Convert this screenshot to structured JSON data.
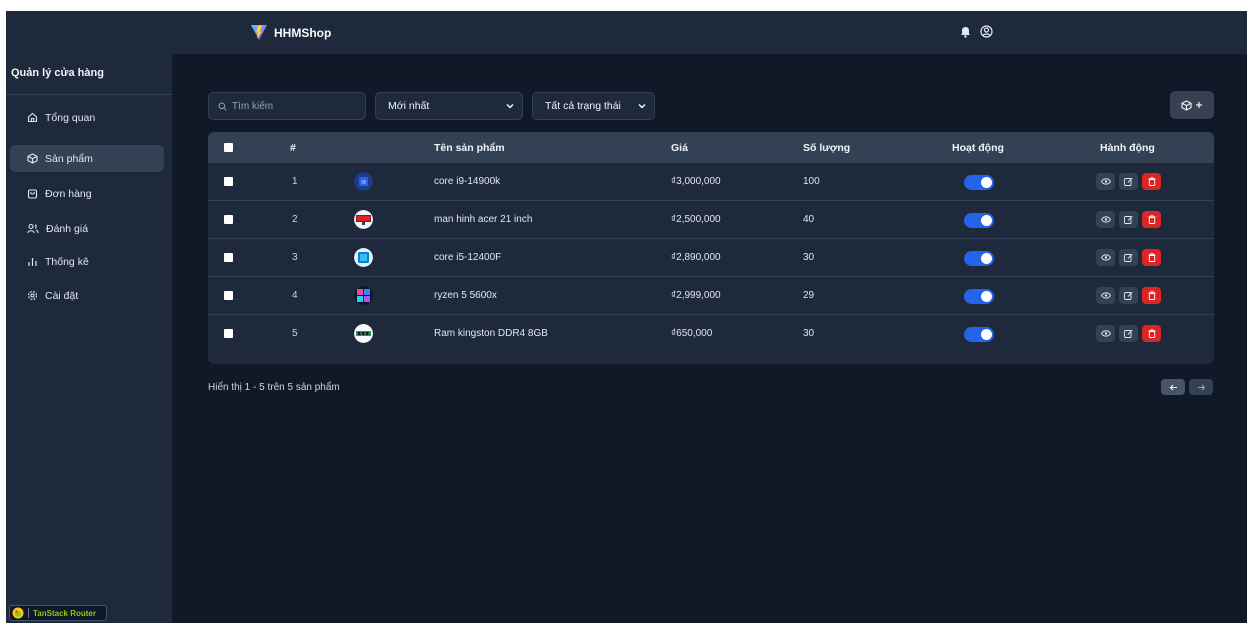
{
  "header": {
    "brand": "HHMShop"
  },
  "sidebar": {
    "title": "Quản lý cửa hàng",
    "items": [
      {
        "label": "Tổng quan",
        "icon": "home-icon",
        "active": false
      },
      {
        "label": "Sản phẩm",
        "icon": "package-icon",
        "active": true
      },
      {
        "label": "Đơn hàng",
        "icon": "shopping-bag-icon",
        "active": false
      },
      {
        "label": "Đánh giá",
        "icon": "users-icon",
        "active": false
      },
      {
        "label": "Thống kê",
        "icon": "bar-chart-icon",
        "active": false
      },
      {
        "label": "Cài đặt",
        "icon": "gear-icon",
        "active": false
      }
    ],
    "devtools": "TanStack Router"
  },
  "filters": {
    "search_placeholder": "Tìm kiếm",
    "sort": "Mới nhất",
    "status": "Tất cả trạng thái"
  },
  "table": {
    "columns": [
      "#",
      "Tên sản phẩm",
      "Giá",
      "Số lượng",
      "Hoạt động",
      "Hành động"
    ],
    "rows": [
      {
        "index": "1",
        "name": "core i9-14900k",
        "price": "₫3,000,000",
        "qty": "100",
        "active": true
      },
      {
        "index": "2",
        "name": "man hinh acer 21 inch",
        "price": "₫2,500,000",
        "qty": "40",
        "active": true
      },
      {
        "index": "3",
        "name": "core i5-12400F",
        "price": "₫2,890,000",
        "qty": "30",
        "active": true
      },
      {
        "index": "4",
        "name": "ryzen 5 5600x",
        "price": "₫2,999,000",
        "qty": "29",
        "active": true
      },
      {
        "index": "5",
        "name": "Ram kingston DDR4 8GB",
        "price": "₫650,000",
        "qty": "30",
        "active": true
      }
    ]
  },
  "pagination": {
    "summary": "Hiển thị 1 - 5 trên 5 sản phẩm"
  },
  "colors": {
    "background": "#111827",
    "panel": "#1e293b",
    "accent": "#2563eb",
    "danger": "#dc2626"
  }
}
